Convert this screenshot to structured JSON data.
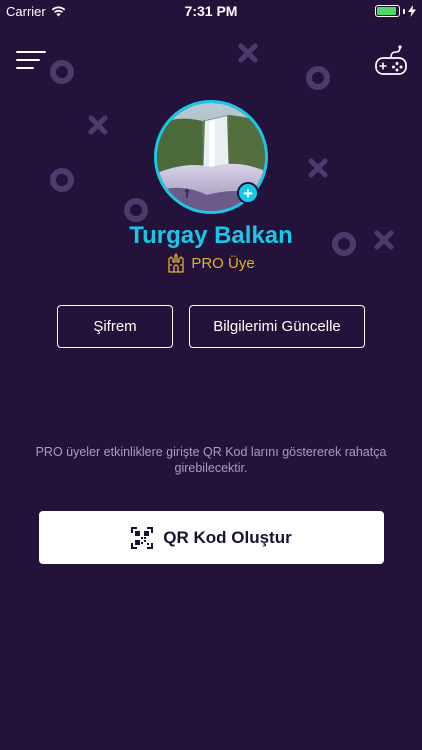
{
  "status_bar": {
    "carrier": "Carrier",
    "time": "7:31 PM",
    "battery_level": 0.9
  },
  "header": {
    "menu_icon": "hamburger-menu-icon",
    "gamepad_icon": "gamepad-icon"
  },
  "profile": {
    "avatar_image": "waterfall-landscape-photo",
    "add_icon": "plus-icon",
    "add_symbol": "+",
    "name": "Turgay Balkan",
    "badge_icon": "castle-icon",
    "membership": "PRO Üye"
  },
  "actions": {
    "password_label": "Şifrem",
    "update_label": "Bilgilerimi Güncelle"
  },
  "info": {
    "message": "PRO üyeler etkinliklere girişte QR Kod larını göstererek rahatça girebilecektir."
  },
  "qr": {
    "icon": "qr-code-icon",
    "label": "QR Kod Oluştur"
  },
  "colors": {
    "background": "#23133a",
    "accent": "#19c8e8",
    "gold": "#e2b036",
    "decoration": "#4f3a6e"
  }
}
